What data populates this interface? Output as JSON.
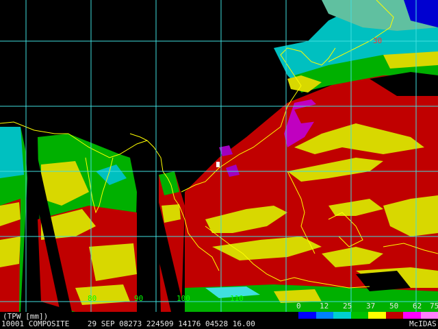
{
  "product": {
    "label": "(TPW [mm])",
    "info_line": "10001 COMPOSITE    29 SEP 08273 224509 14176 04528 16.00",
    "credit": "McIDAS"
  },
  "colorbar": {
    "ticks": [
      "0",
      "12",
      "25",
      "37",
      "50",
      "62",
      "75"
    ],
    "colors": [
      "#0000ff",
      "#0080ff",
      "#00d0d0",
      "#00c000",
      "#ffff00",
      "#c00000",
      "#ff00ff",
      "#ff80ff"
    ]
  },
  "grid_labels": {
    "longitudes": [
      "80",
      "90",
      "100",
      "110"
    ],
    "latitude": "30"
  },
  "image": {
    "description_colors": {
      "background": "#000000",
      "grid": "#40e0e0",
      "coastline": "#ffff00"
    }
  }
}
